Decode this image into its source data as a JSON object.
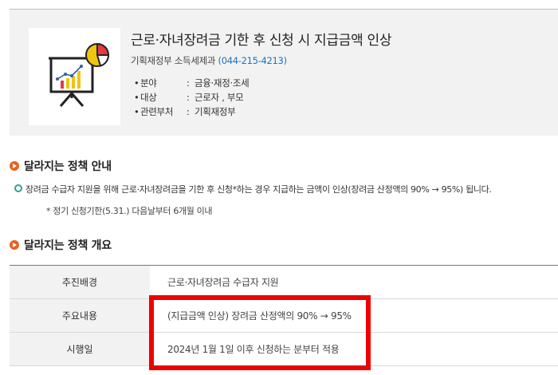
{
  "header": {
    "title": "근로·자녀장려금 기한 후 신청 시 지급금액 인상",
    "department": "기획재정부 소득세제과",
    "phone": "(044-215-4213)",
    "meta": [
      {
        "bullet": "•",
        "key": "분야",
        "colon": ":",
        "value": "금융·재정·조세"
      },
      {
        "bullet": "•",
        "key": "대상",
        "colon": ":",
        "value": "근로자 , 부모"
      },
      {
        "bullet": "•",
        "key": "관련부처",
        "colon": ":",
        "value": "기획재정부"
      }
    ],
    "thumbnail_icon": "presentation-chart-icon"
  },
  "guide": {
    "heading": "달라지는 정책 안내",
    "description": "장려금 수급자 지원을 위해 근로·자녀장려금을 기한 후 신청*하는 경우 지급하는 금액이 인상(장려금 산정액의 90% → 95%) 됩니다.",
    "note": "* 정기 신청기한(5.31.) 다음날부터 6개월 이내"
  },
  "overview": {
    "heading": "달라지는 정책 개요",
    "rows": [
      {
        "label": "추진배경",
        "value": "근로·자녀장려금 수급자 지원"
      },
      {
        "label": "주요내용",
        "value": "(지급금액 인상) 장려금 산정액의 90% → 95%"
      },
      {
        "label": "시행일",
        "value": "2024년 1월 1일 이후 신청하는 분부터 적용"
      }
    ]
  },
  "colors": {
    "accent_orange": "#e8621f",
    "phone_blue": "#1a73c8",
    "highlight_red": "#ee0000",
    "bullet_green": "#2aa58a"
  }
}
